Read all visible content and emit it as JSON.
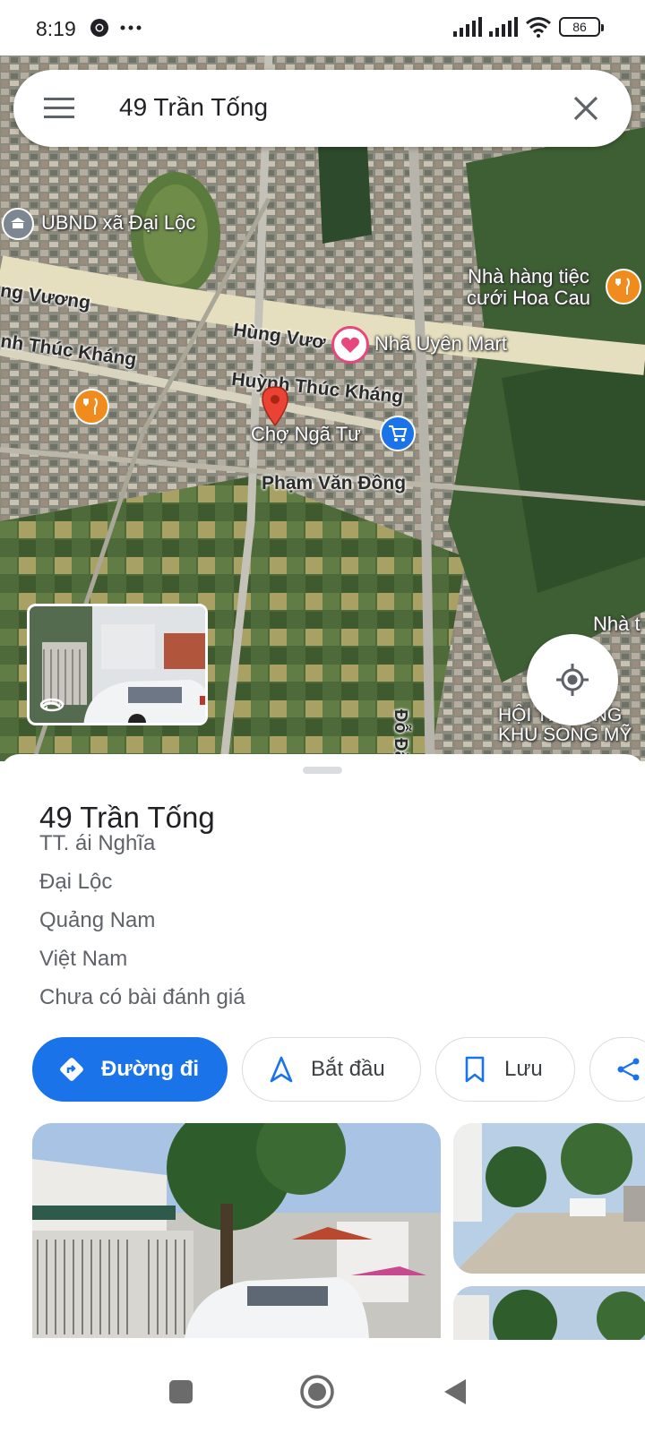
{
  "status_bar": {
    "time": "8:19",
    "battery": "86"
  },
  "search": {
    "query": "49 Trần Tống"
  },
  "map": {
    "labels": [
      "UBND xã Đại Lộc",
      "Nhà hàng tiệc cưới Hoa Cau",
      "Hùng Vươ",
      "Nhã Uyên Mart",
      "Huỳnh Thúc Kháng",
      "Chợ Ngã Tư",
      "Phạm Văn Đồng",
      "ng Vương",
      "nh Thúc Kháng",
      "Nhà t",
      "HỘI TRƯỜNG KHU SONG MỸ",
      "Đỗ Đă"
    ]
  },
  "place": {
    "title": "49 Trần Tống",
    "address_lines": [
      "TT. ái Nghĩa",
      "Đại Lộc",
      "Quảng Nam",
      "Việt Nam"
    ],
    "reviews": "Chưa có bài đánh giá"
  },
  "actions": {
    "directions": "Đường đi",
    "start": "Bắt đầu",
    "save": "Lưu"
  },
  "colors": {
    "accent": "#1a73e8",
    "pin_red": "#ea4335",
    "shopping_blue": "#1a73e8",
    "food_orange": "#f28b1d",
    "heart_pink": "#e8467c"
  },
  "icons": {
    "menu": "menu-icon",
    "clear": "close-icon",
    "locate": "my-location-icon",
    "directions": "directions-icon",
    "start": "navigation-arrow-icon",
    "save": "bookmark-icon",
    "share": "share-icon"
  }
}
